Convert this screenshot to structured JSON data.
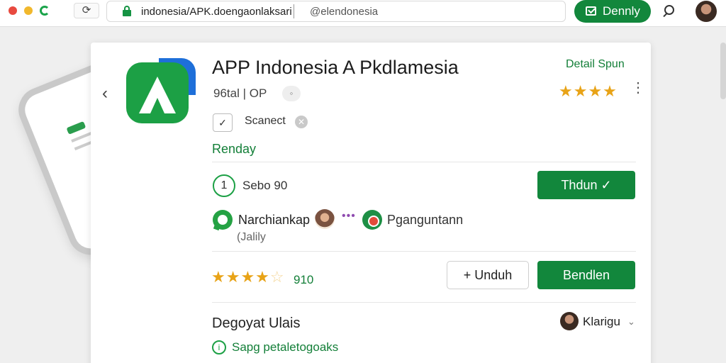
{
  "browser": {
    "url": "indonesia/APK.doengaonlaksari",
    "url_secondary": "@elendonesia",
    "top_button_label": "Dennly",
    "reload_symbol": "⟳"
  },
  "app": {
    "title": "APP Indonesia A Pkdlamesia",
    "meta": "96tal | OP",
    "meta_badge": "◦",
    "secured_label": "Scanect",
    "secured_symbol": "✓",
    "section_link": "Renday",
    "detail_link": "Detail Spun",
    "rating_top": "★★★★",
    "version_number": "1",
    "version_text": "Sebo 90",
    "primary_button": "Thdun ✓",
    "developer_name": "Narchiankap",
    "developer_sub": "(Jalily",
    "partner_name": "Pganguntann",
    "stars_full": "★★★★",
    "stars_empty": "☆",
    "stars_count": "910",
    "unduh_button": "+ Unduh",
    "secondary_button": "Bendlen",
    "reviews_title": "Degoyat Ulais",
    "reviews_language": "Klarigu",
    "reviews_link": "Sapg petaletogoaks"
  },
  "colors": {
    "brand_green": "#12873c",
    "link_green": "#137f38",
    "star_yellow": "#e8a317",
    "icon_blue": "#1e6fd9"
  },
  "icons": {
    "back": "‹",
    "kebab": "⋮",
    "chevron_down": "⌄"
  }
}
